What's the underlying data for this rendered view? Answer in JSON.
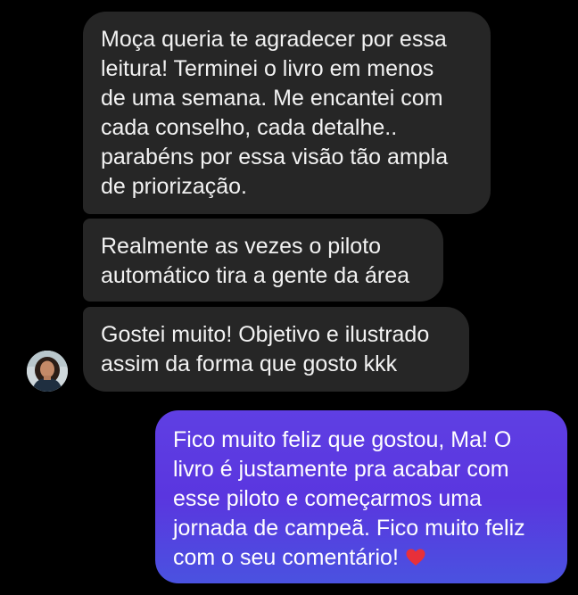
{
  "conversation": {
    "messages": [
      {
        "sender": "them",
        "text": "Moça queria te agradecer por essa\nleitura! Terminei o livro em menos\nde uma semana. Me encantei com\ncada conselho, cada detalhe..\nparabéns por essa visão tão ampla\nde priorização."
      },
      {
        "sender": "them",
        "text": "Realmente as vezes o piloto\nautomático tira a gente da área"
      },
      {
        "sender": "them",
        "text": "Gostei muito! Objetivo e ilustrado\nassim da forma que gosto kkk"
      },
      {
        "sender": "me",
        "text": "Fico muito feliz que gostou, Ma! O\nlivro é justamente pra acabar com\nesse piloto e começarmos uma\njornada de campeã. Fico muito feliz\ncom o seu comentário!",
        "emoji": "heart-icon"
      }
    ]
  },
  "colors": {
    "background": "#000000",
    "incoming_bubble": "#262626",
    "outgoing_gradient_top": "#5f3fe3",
    "outgoing_gradient_bottom": "#4a52e0",
    "heart": "#e8303a"
  }
}
